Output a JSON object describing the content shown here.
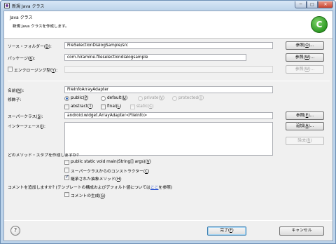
{
  "window": {
    "title": "新規 Java クラス",
    "min": "─",
    "max": "□",
    "close": "✕"
  },
  "header": {
    "title": "Java クラス",
    "description": "新規 Java クラスを作成します。",
    "icon": "class-wizard-icon"
  },
  "form": {
    "source_folder": {
      "label_pre": "ソース・フォルダー(",
      "label_key": "D",
      "label_post": "):",
      "value": "FileSelectionDialogSample/src",
      "button_pre": "参照(",
      "button_key": "O",
      "button_post": ")..."
    },
    "package": {
      "label_pre": "パッケージ(",
      "label_key": "K",
      "label_post": "):",
      "value": "com.hiramine.fileselectiondialogsample",
      "button_pre": "参照(",
      "button_key": "W",
      "button_post": ")..."
    },
    "enclosing": {
      "label_pre": "エンクロージング型(",
      "label_key": "Y",
      "label_post": "):",
      "value": "",
      "checked": false,
      "button_pre": "参照(",
      "button_key": "W",
      "button_post": ")..."
    },
    "name": {
      "label_pre": "名前(",
      "label_key": "M",
      "label_post": "):",
      "value": "FileInfoArrayAdapter"
    },
    "modifiers": {
      "label": "修飾子:",
      "radios": [
        {
          "pre": "public(",
          "key": "P",
          "post": ")",
          "checked": true,
          "enabled": true
        },
        {
          "pre": "default(",
          "key": "U",
          "post": ")",
          "checked": false,
          "enabled": true
        },
        {
          "pre": "private(",
          "key": "V",
          "post": ")",
          "checked": false,
          "enabled": false
        },
        {
          "pre": "protected(",
          "key": "T",
          "post": ")",
          "checked": false,
          "enabled": false
        }
      ],
      "checks": [
        {
          "pre": "abstract(",
          "key": "T",
          "post": ")",
          "checked": false,
          "enabled": true
        },
        {
          "pre": "final(",
          "key": "L",
          "post": ")",
          "checked": false,
          "enabled": true
        },
        {
          "pre": "static(",
          "key": "C",
          "post": ")",
          "checked": false,
          "enabled": false
        }
      ]
    },
    "superclass": {
      "label_pre": "スーパークラス(",
      "label_key": "S",
      "label_post": "):",
      "value": "android.widget.ArrayAdapter<FileInfo>",
      "button_pre": "参照(",
      "button_key": "E",
      "button_post": ")..."
    },
    "interfaces": {
      "label_pre": "インターフェース(",
      "label_key": "I",
      "label_post": "):",
      "add_pre": "追加(",
      "add_key": "A",
      "add_post": ")...",
      "remove_pre": "除去(",
      "remove_key": "R",
      "remove_post": ")"
    },
    "stubs": {
      "question": "どのメソッド・スタブを作成しますか?",
      "options": [
        {
          "pre": "public static void main(String[] args)(",
          "key": "V",
          "post": ")",
          "checked": false
        },
        {
          "pre": "スーパークラスからのコンストラクター(",
          "key": "C",
          "post": ")",
          "checked": false
        },
        {
          "pre": "継承された抽象メソッド(",
          "key": "H",
          "post": ")",
          "checked": true
        }
      ]
    },
    "comments": {
      "question_pre": "コメントを追加しますか? (テンプレートの構成およびデフォルト値については",
      "link": "ここ",
      "question_post": "を参照)",
      "option_pre": "コメントの生成(",
      "option_key": "G",
      "option_post": ")",
      "checked": false
    }
  },
  "footer": {
    "help": "?",
    "finish_pre": "完了(",
    "finish_key": "F",
    "finish_post": ")",
    "cancel": "キャンセル"
  }
}
